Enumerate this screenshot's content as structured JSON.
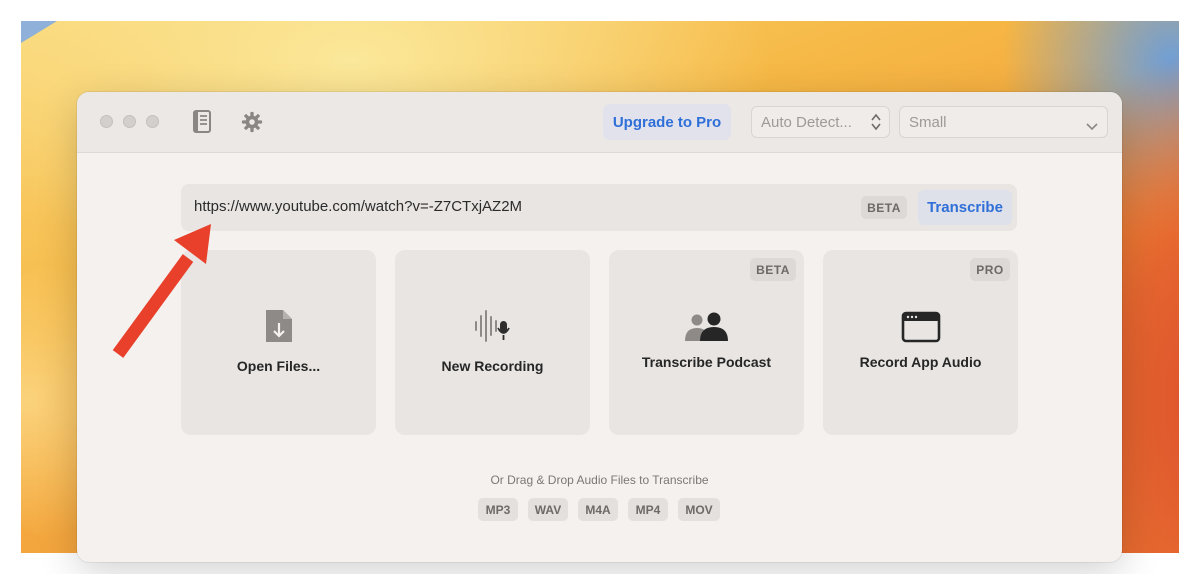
{
  "toolbar": {
    "upgrade_label": "Upgrade to Pro",
    "language_select": "Auto Detect...",
    "model_select": "Small"
  },
  "url_bar": {
    "value": "https://www.youtube.com/watch?v=-Z7CTxjAZ2M",
    "badge": "BETA",
    "action_label": "Transcribe"
  },
  "cards": [
    {
      "label": "Open Files...",
      "icon": "file-download-icon",
      "badge": ""
    },
    {
      "label": "New Recording",
      "icon": "waveform-mic-icon",
      "badge": ""
    },
    {
      "label": "Transcribe Podcast",
      "icon": "people-icon",
      "badge": "BETA"
    },
    {
      "label": "Record App Audio",
      "icon": "app-window-icon",
      "badge": "PRO"
    }
  ],
  "drop_hint": "Or Drag & Drop Audio Files to Transcribe",
  "file_types": [
    "MP3",
    "WAV",
    "M4A",
    "MP4",
    "MOV"
  ],
  "colors": {
    "accent": "#2f6fd8",
    "annotation_arrow": "#e8402b"
  }
}
